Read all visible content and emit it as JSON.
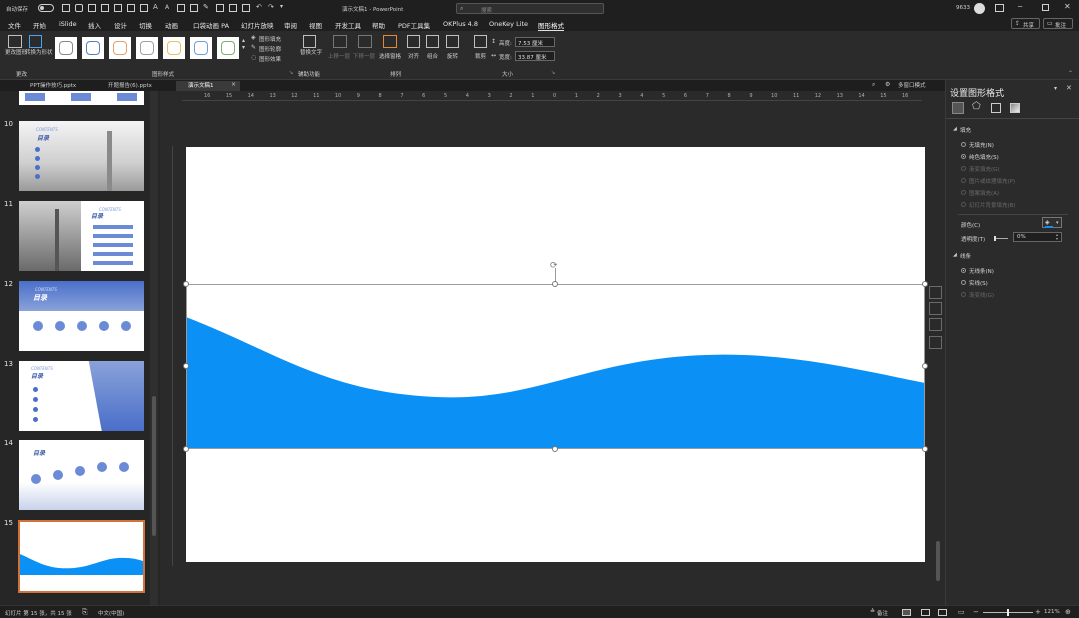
{
  "titlebar": {
    "autosave": "自动保存",
    "autosave_state": "关",
    "doc_title": "演示文稿1 - PowerPoint",
    "search_placeholder": "搜索",
    "user_count": "9633"
  },
  "menu": {
    "items": [
      "文件",
      "开始",
      "iSlide",
      "插入",
      "设计",
      "切换",
      "动画",
      "口袋动画 PA",
      "幻灯片放映",
      "审阅",
      "视图",
      "开发工具",
      "帮助",
      "PDF工具集",
      "OKPlus 4.8",
      "OneKey Lite",
      "图形格式"
    ],
    "share": "共享",
    "comments": "批注"
  },
  "ribbon": {
    "change_shape": "更改图形",
    "convert_shape": "转换为形状",
    "group_change": "更改",
    "shape_fill": "图形填充",
    "shape_outline": "图形轮廓",
    "shape_effects": "图形效果",
    "group_styles": "图形样式",
    "replace_text": "替换文字",
    "group_access": "辅助功能",
    "bring_forward": "上移一层",
    "send_backward": "下移一层",
    "selection_pane": "选择窗格",
    "align": "对齐",
    "group": "组合",
    "rotate": "旋转",
    "group_arrange": "排列",
    "crop": "裁剪",
    "height_label": "高度:",
    "height_value": "7.53 厘米",
    "width_label": "宽度:",
    "width_value": "33.87 厘米",
    "group_size": "大小"
  },
  "doc_tabs": [
    "PPT操作技巧.pptx",
    "开题报告(6).pptx",
    "演示文稿1"
  ],
  "view_controls": {
    "multi_window": "多窗口模式"
  },
  "thumbnails": [
    {
      "num": "10",
      "title": "目录",
      "sub": "CONTENTS"
    },
    {
      "num": "11",
      "title": "目录",
      "sub": "CONTENTS"
    },
    {
      "num": "12",
      "title": "目录",
      "sub": "CONTENTS"
    },
    {
      "num": "13",
      "title": "目录",
      "sub": "CONTENTS"
    },
    {
      "num": "14",
      "title": "目录",
      "sub": ""
    },
    {
      "num": "15",
      "title": "",
      "sub": ""
    }
  ],
  "ruler": [
    "16",
    "15",
    "14",
    "13",
    "12",
    "11",
    "10",
    "9",
    "8",
    "7",
    "6",
    "5",
    "4",
    "3",
    "2",
    "1",
    "0",
    "1",
    "2",
    "3",
    "4",
    "5",
    "6",
    "7",
    "8",
    "9",
    "10",
    "11",
    "12",
    "13",
    "14",
    "15",
    "16"
  ],
  "pane": {
    "title": "设置图形格式",
    "fill_section": "填充",
    "fill_options": [
      "无填充(N)",
      "纯色填充(S)",
      "渐变填充(G)",
      "图片或纹理填充(P)",
      "图案填充(A)",
      "幻灯片背景填充(B)"
    ],
    "color_label": "颜色(C)",
    "transparency_label": "透明度(T)",
    "transparency_value": "0%",
    "line_section": "线条",
    "line_options": [
      "无线条(N)",
      "实线(S)",
      "渐变线(G)"
    ]
  },
  "colors": {
    "wave": "#0b91f5",
    "accent": "#4a6fc9",
    "selected_border": "#d0733a"
  },
  "status": {
    "slide_info": "幻灯片 第 15 张，共 15 张",
    "language": "中文(中国)",
    "notes": "备注",
    "zoom": "121%"
  }
}
